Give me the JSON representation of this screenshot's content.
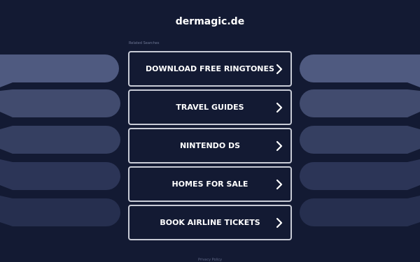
{
  "site": {
    "title": "dermagic.de"
  },
  "related": {
    "label": "Related Searches",
    "links": [
      {
        "label": "DOWNLOAD FREE RINGTONES"
      },
      {
        "label": "TRAVEL GUIDES"
      },
      {
        "label": "NINTENDO DS"
      },
      {
        "label": "HOMES FOR SALE"
      },
      {
        "label": "BOOK AIRLINE TICKETS"
      }
    ]
  },
  "footer": {
    "text": "Privacy Policy"
  },
  "colors": {
    "background": "#131a33",
    "border": "#c8cbd6",
    "deco_shades": [
      "#4f5a80",
      "#414b6e",
      "#353f61",
      "#2c3557",
      "#262f4f"
    ]
  },
  "icons": {
    "link_chevron": "chevron-right-icon"
  }
}
